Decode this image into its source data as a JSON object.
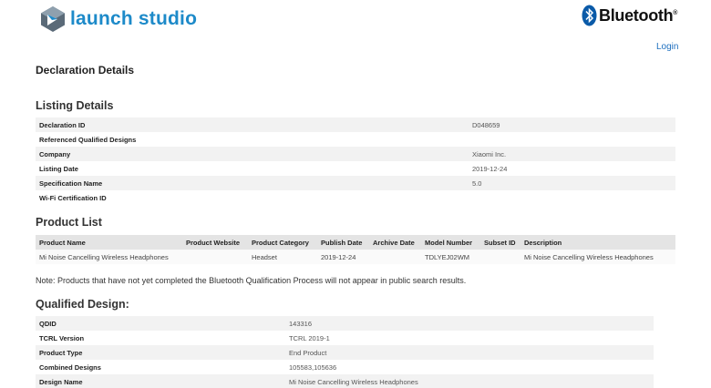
{
  "brand": {
    "launch_studio": "launch studio",
    "bluetooth": "Bluetooth",
    "registered": "®"
  },
  "nav": {
    "login": "Login"
  },
  "page_title": "Declaration Details",
  "listing": {
    "title": "Listing Details",
    "rows": [
      {
        "label": "Declaration ID",
        "value": "D048659"
      },
      {
        "label": "Referenced Qualified Designs",
        "value": ""
      },
      {
        "label": "Company",
        "value": "Xiaomi Inc."
      },
      {
        "label": "Listing Date",
        "value": "2019-12-24"
      },
      {
        "label": "Specification Name",
        "value": "5.0"
      },
      {
        "label": "Wi-Fi Certification ID",
        "value": ""
      }
    ]
  },
  "product_list": {
    "title": "Product List",
    "headers": [
      "Product Name",
      "Product Website",
      "Product Category",
      "Publish Date",
      "Archive Date",
      "Model Number",
      "Subset ID",
      "Description"
    ],
    "rows": [
      [
        "Mi Noise Cancelling Wireless Headphones",
        "",
        "Headset",
        "2019-12-24",
        "",
        "TDLYEJ02WM",
        "",
        "Mi Noise Cancelling Wireless Headphones"
      ]
    ]
  },
  "note": "Note: Products that have not yet completed the Bluetooth Qualification Process will not appear in public search results.",
  "qualified": {
    "title": "Qualified Design:",
    "rows": [
      {
        "label": "QDID",
        "value": "143316"
      },
      {
        "label": "TCRL Version",
        "value": "TCRL 2019-1"
      },
      {
        "label": "Product Type",
        "value": "End Product"
      },
      {
        "label": "Combined Designs",
        "value": "105583,105636"
      },
      {
        "label": "Design Name",
        "value": "Mi Noise Cancelling Wireless Headphones"
      }
    ]
  },
  "colors": {
    "brand_blue": "#1d8ac9",
    "link_blue": "#1d6fbf",
    "bt_blue": "#0a5aa8"
  }
}
